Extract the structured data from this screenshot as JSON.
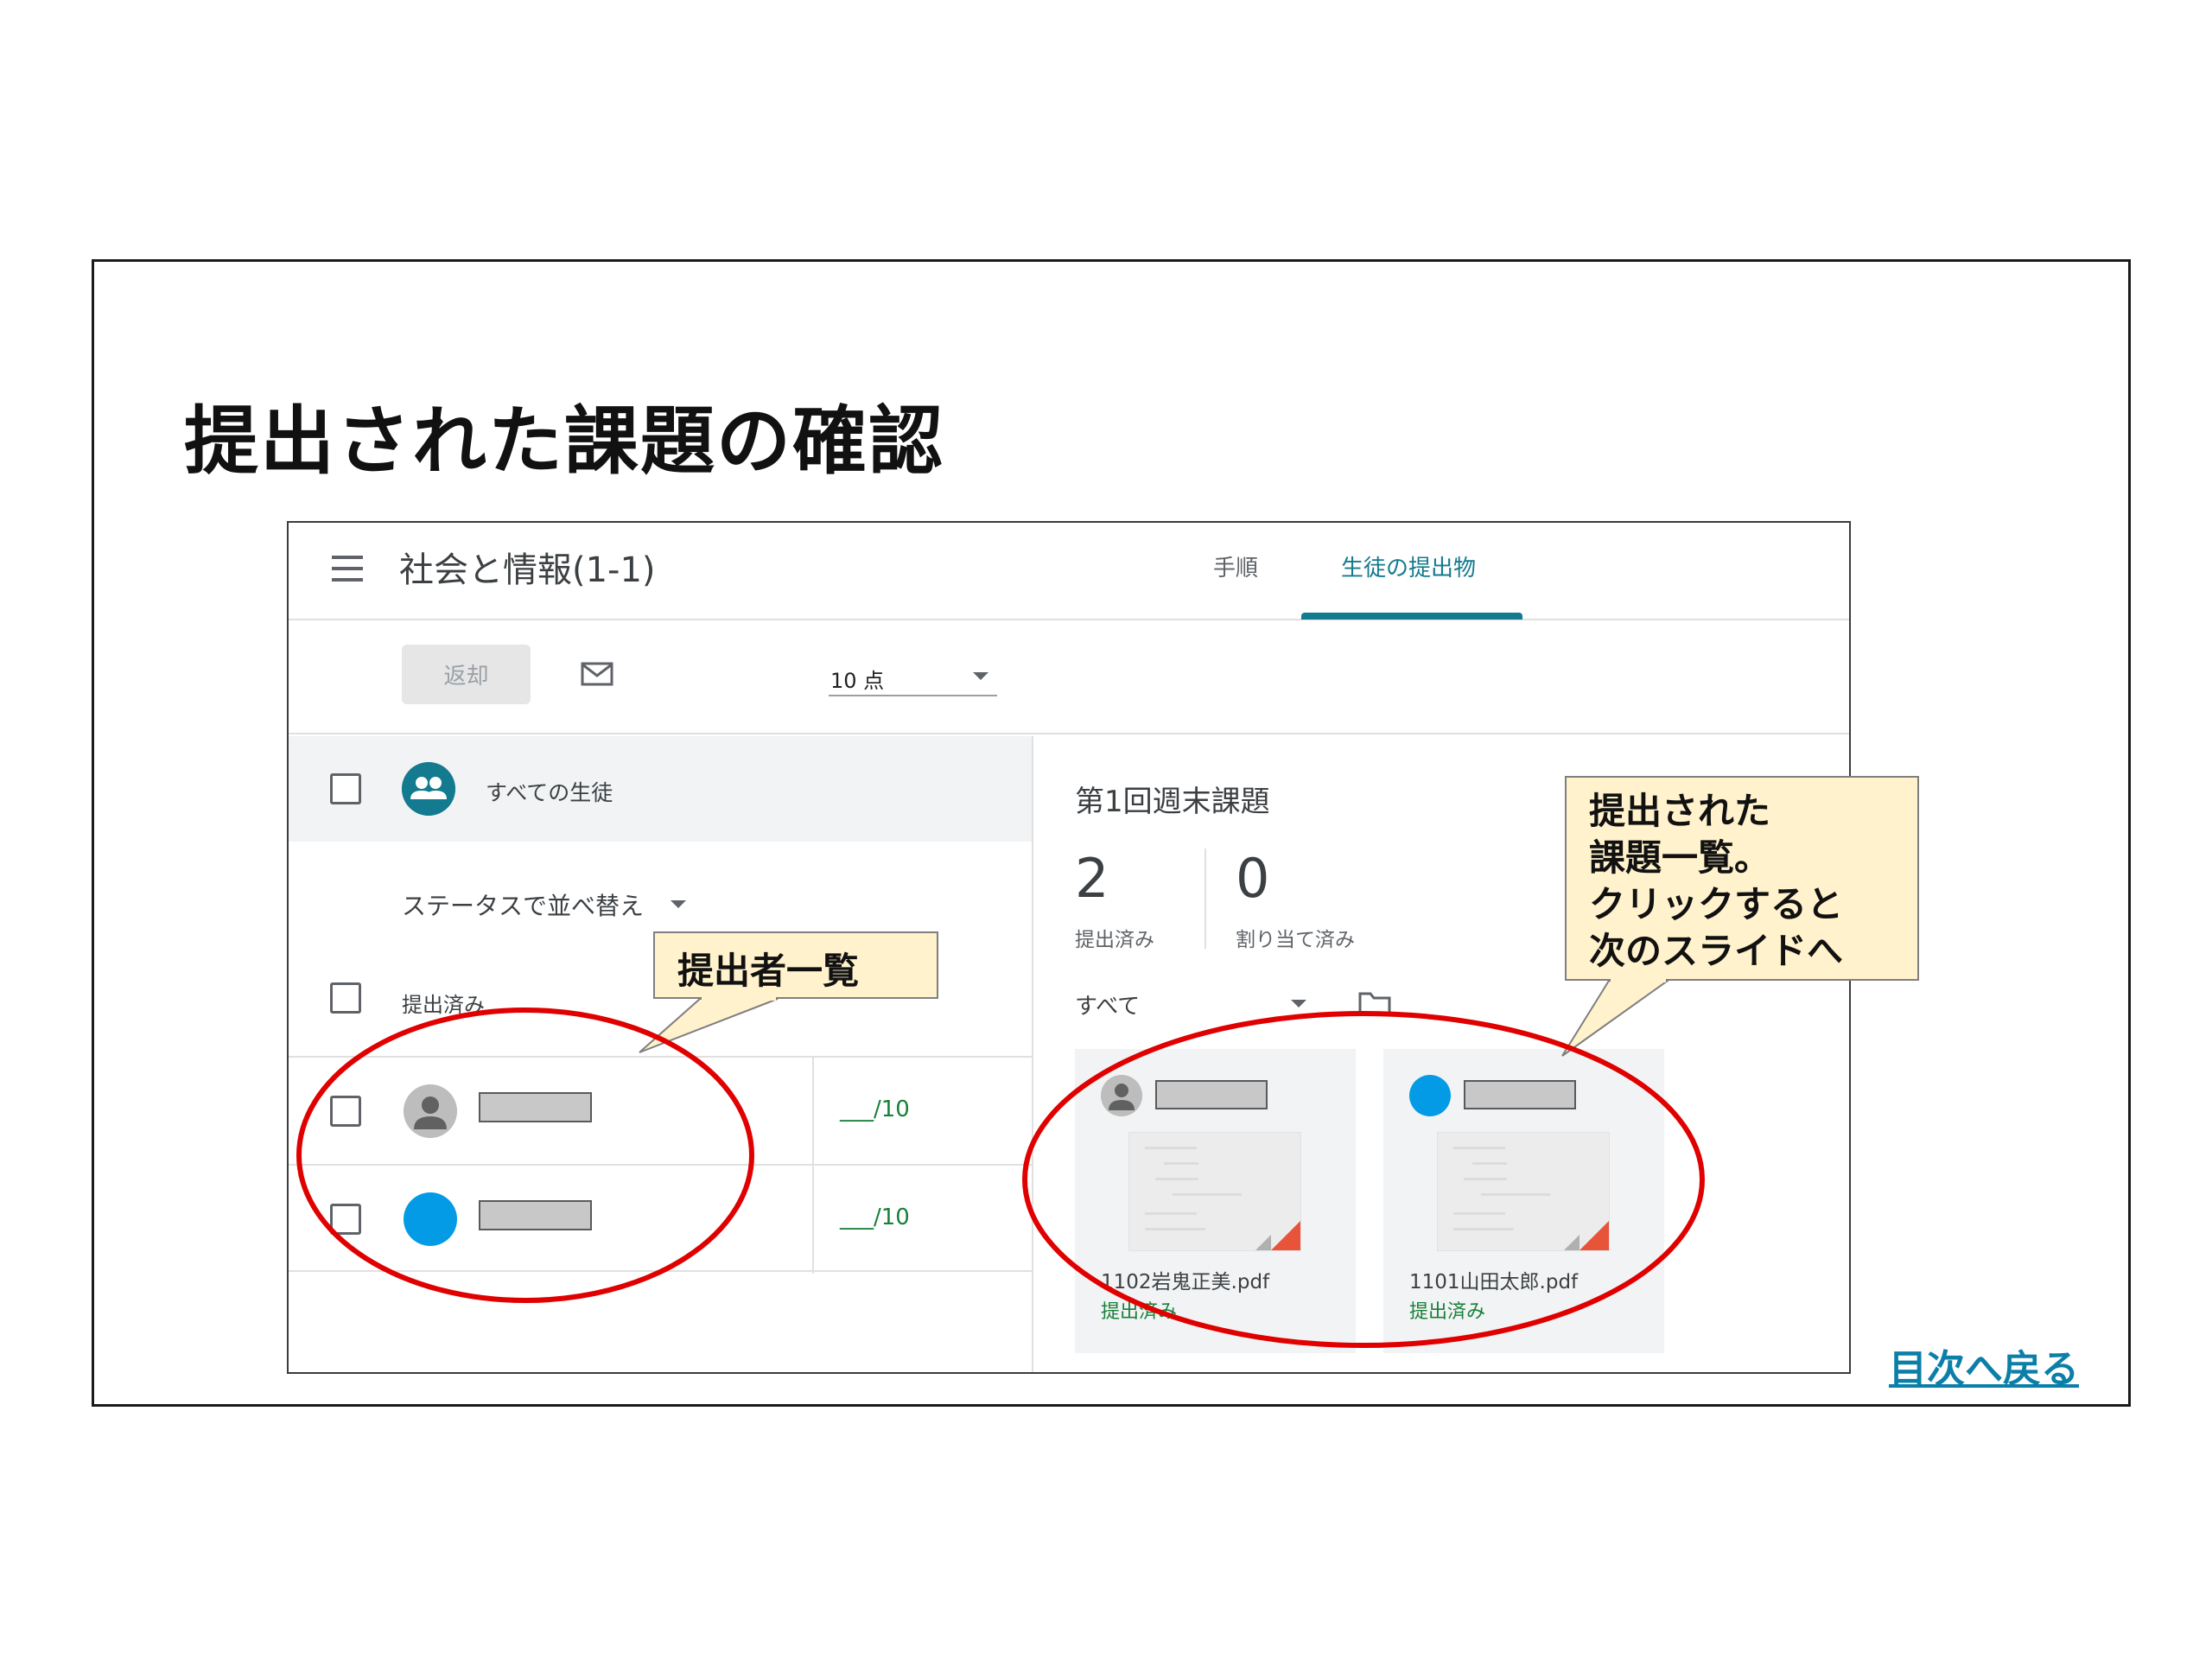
{
  "slide": {
    "title": "提出された課題の確認",
    "toc_link": "目次へ戻る"
  },
  "classroom": {
    "class_title": "社会と情報(1-1)",
    "tabs": [
      {
        "label": "手順",
        "active": false
      },
      {
        "label": "生徒の提出物",
        "active": true
      }
    ],
    "toolbar": {
      "return_button": "返却",
      "points": "10 点"
    },
    "left_pane": {
      "all_students": "すべての生徒",
      "sort_label": "ステータスで並べ替え",
      "group_label": "提出済み",
      "students": [
        {
          "grade": "___/10",
          "avatar": "gray-person"
        },
        {
          "grade": "___/10",
          "avatar": "blue-circle"
        }
      ]
    },
    "right_pane": {
      "assignment_title": "第1回週末課題",
      "stats": [
        {
          "number": "2",
          "label": "提出済み"
        },
        {
          "number": "0",
          "label": "割り当て済み"
        }
      ],
      "filter": "すべて",
      "cards": [
        {
          "file_name": "1102岩鬼正美.pdf",
          "status": "提出済み",
          "avatar": "gray-person"
        },
        {
          "file_name": "1101山田太郎.pdf",
          "status": "提出済み",
          "avatar": "blue-circle"
        }
      ]
    }
  },
  "callouts": {
    "left": "提出者一覧",
    "right": [
      "提出された",
      "課題一覧。",
      "クリックすると",
      "次のスライドへ"
    ]
  },
  "colors": {
    "accent_teal": "#137a8f",
    "status_green": "#188038",
    "annotation_red": "#e00000",
    "callout_fill": "#fff2cc",
    "link_blue": "#0b7fa8"
  }
}
